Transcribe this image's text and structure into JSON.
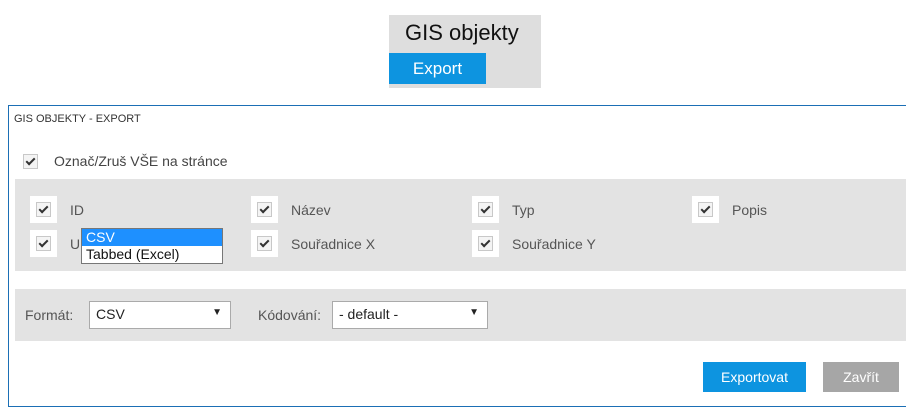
{
  "menu": {
    "title": "GIS objekty",
    "export_label": "Export"
  },
  "dialog": {
    "title": "GIS OBJEKTY - EXPORT",
    "toggle_all_label": "Označ/Zruš VŠE na stránce",
    "fields": [
      {
        "label": "ID",
        "checked": true
      },
      {
        "label": "Název",
        "checked": true
      },
      {
        "label": "Typ",
        "checked": true
      },
      {
        "label": "Popis",
        "checked": true
      },
      {
        "label": "URL",
        "checked": true
      },
      {
        "label": "Souřadnice X",
        "checked": true
      },
      {
        "label": "Souřadnice Y",
        "checked": true
      }
    ],
    "format": {
      "label": "Formát:",
      "selected": "CSV",
      "options": [
        "CSV",
        "Tabbed (Excel)"
      ]
    },
    "encoding": {
      "label": "Kódování:",
      "selected": "- default -"
    },
    "buttons": {
      "export": "Exportovat",
      "close": "Zavřít"
    }
  },
  "colors": {
    "accent": "#0d94e0",
    "panel": "#e3e3e3",
    "close_button": "#a6a6a6"
  }
}
